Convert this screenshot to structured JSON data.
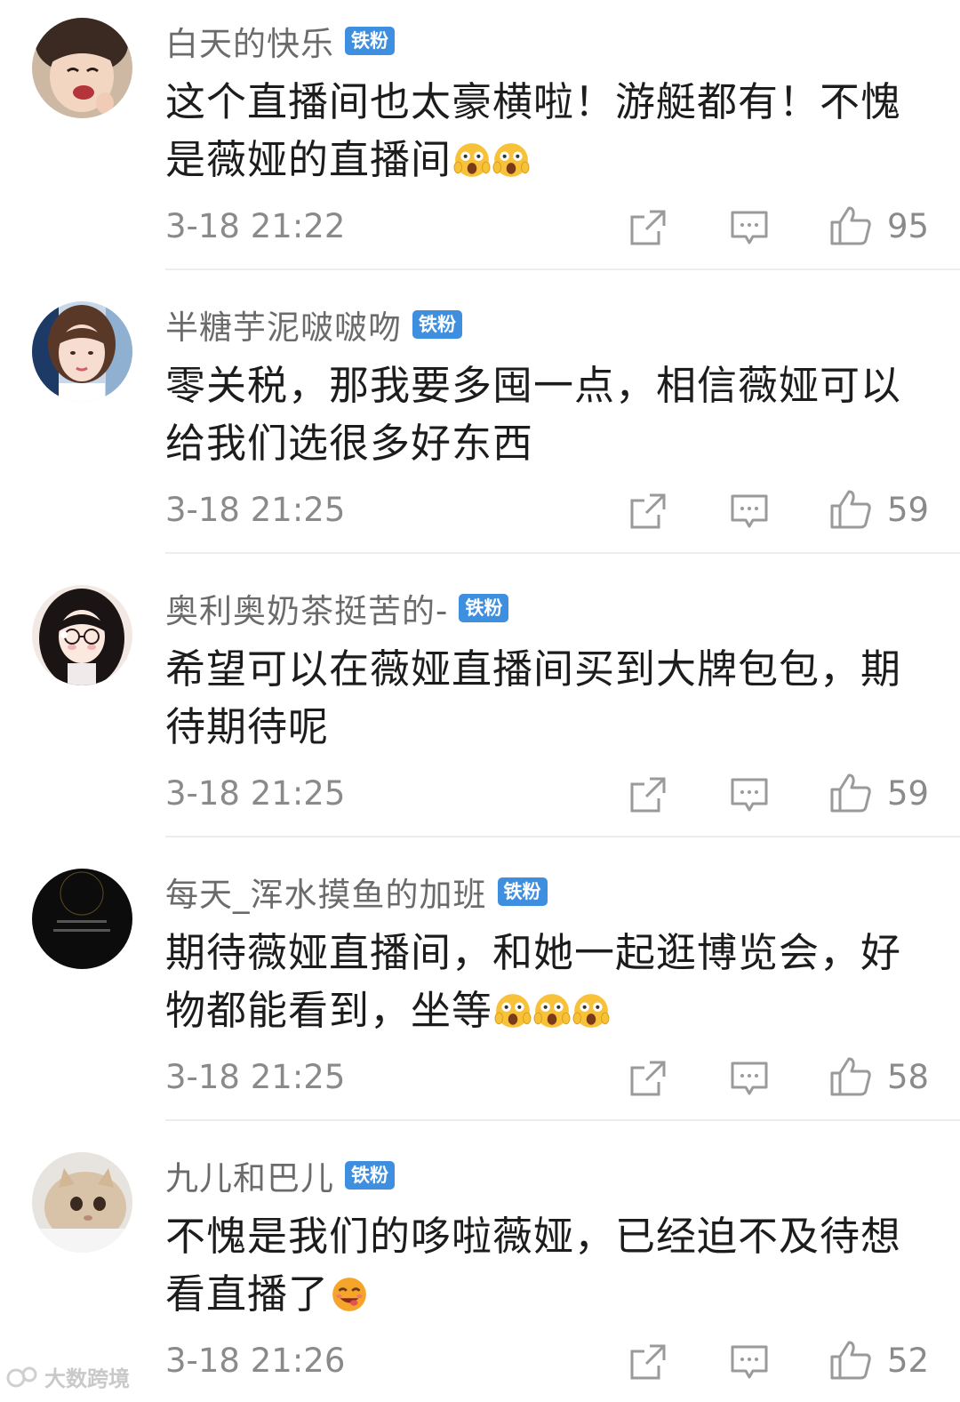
{
  "badge_label": "铁粉",
  "comments": [
    {
      "username": "白天的快乐",
      "content": "这个直播间也太豪横啦！游艇都有！不愧是薇娅的直播间",
      "emoji": [
        "scream-emoji",
        "scream-emoji"
      ],
      "time": "3-18 21:22",
      "likes": "95"
    },
    {
      "username": "半糖芋泥啵啵吻",
      "content": "零关税，那我要多囤一点，相信薇娅可以给我们选很多好东西",
      "emoji": [],
      "time": "3-18 21:25",
      "likes": "59"
    },
    {
      "username": "奥利奥奶茶挺苦的-",
      "content": "希望可以在薇娅直播间买到大牌包包，期待期待呢",
      "emoji": [],
      "time": "3-18 21:25",
      "likes": "59"
    },
    {
      "username": "每天_浑水摸鱼的加班",
      "content": "期待薇娅直播间，和她一起逛博览会，好物都能看到，坐等",
      "emoji": [
        "scream-emoji",
        "scream-emoji",
        "scream-emoji"
      ],
      "time": "3-18 21:25",
      "likes": "58"
    },
    {
      "username": "九儿和巴儿",
      "content": "不愧是我们的哆啦薇娅，已经迫不及待想看直播了",
      "emoji": [
        "yum-emoji"
      ],
      "time": "3-18 21:26",
      "likes": "52"
    }
  ],
  "watermark": "大数跨境",
  "colors": {
    "badge": "#3f8fe0",
    "meta_text": "#8a8a8a",
    "username": "#6b6b6b"
  }
}
